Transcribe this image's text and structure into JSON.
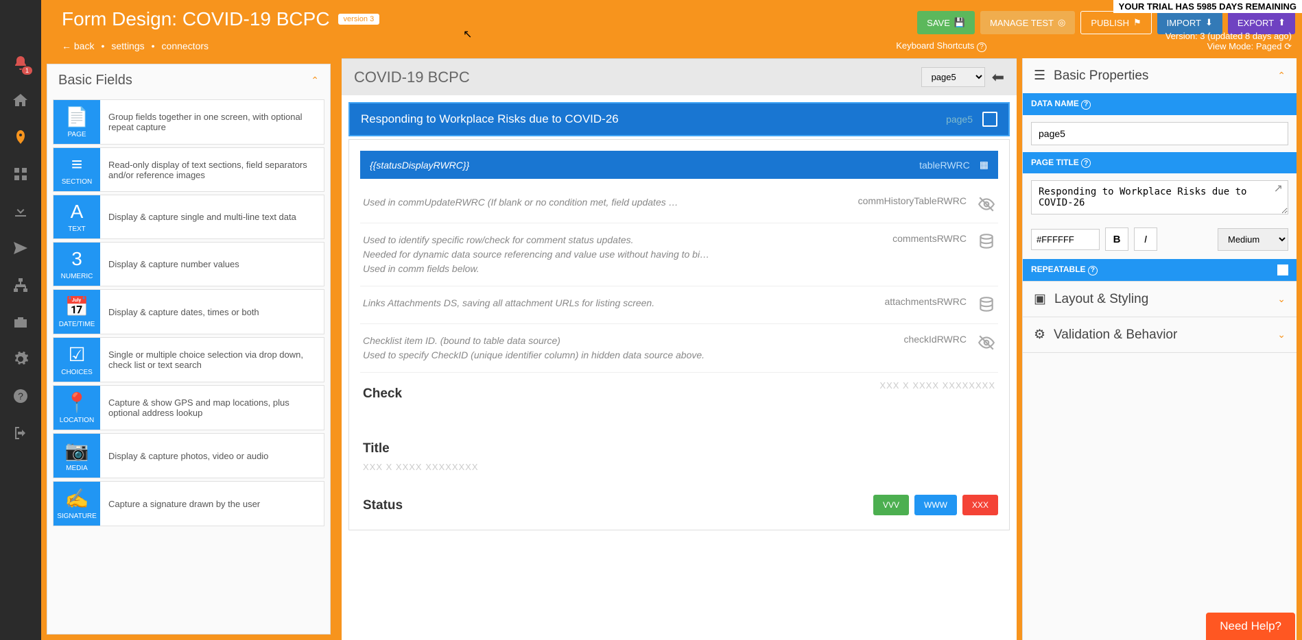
{
  "trial": "YOUR TRIAL HAS 5985 DAYS REMAINING",
  "header": {
    "title": "Form Design: COVID-19 BCPC",
    "version_badge": "version 3",
    "buttons": {
      "save": "SAVE",
      "manage": "MANAGE TEST",
      "publish": "PUBLISH",
      "import": "IMPORT",
      "export": "EXPORT"
    }
  },
  "subheader": {
    "back": "back",
    "settings": "settings",
    "connectors": "connectors",
    "kbd": "Keyboard Shortcuts",
    "version_info": "Version: 3 (updated 8 days ago)",
    "view_mode": "View Mode: Paged"
  },
  "fields_panel": {
    "title": "Basic Fields",
    "items": [
      {
        "icon": "page",
        "label": "PAGE",
        "desc": "Group fields together in one screen, with optional repeat capture"
      },
      {
        "icon": "section",
        "label": "SECTION",
        "desc": "Read-only display of text sections, field separators and/or reference images"
      },
      {
        "icon": "text",
        "label": "TEXT",
        "desc": "Display & capture single and multi-line text data"
      },
      {
        "icon": "numeric",
        "label": "NUMERIC",
        "desc": "Display & capture number values"
      },
      {
        "icon": "datetime",
        "label": "DATE/TIME",
        "desc": "Display & capture dates, times or both"
      },
      {
        "icon": "choices",
        "label": "CHOICES",
        "desc": "Single or multiple choice selection via drop down, check list or text search"
      },
      {
        "icon": "location",
        "label": "LOCATION",
        "desc": "Capture & show GPS and map locations, plus optional address lookup"
      },
      {
        "icon": "media",
        "label": "MEDIA",
        "desc": "Display & capture photos, video or audio"
      },
      {
        "icon": "signature",
        "label": "SIGNATURE",
        "desc": "Capture a signature drawn by the user"
      }
    ]
  },
  "canvas": {
    "title": "COVID-19 BCPC",
    "page_select": "page5",
    "page_header": "Responding to Workplace Risks due to COVID-26",
    "page_name": "page5",
    "section_expr": "{{statusDisplayRWRC}}",
    "section_name": "tableRWRC",
    "rows": [
      {
        "text": "Used in commUpdateRWRC (If blank or no condition met, field updates …",
        "name": "commHistoryTableRWRC",
        "icon": "eye-off"
      },
      {
        "text": "Used to identify specific row/check for comment status updates.\nNeeded for dynamic data source referencing and value use without having to bi…\nUsed in comm fields below.",
        "name": "commentsRWRC",
        "icon": "db"
      },
      {
        "text": "Links Attachments DS, saving all attachment URLs for listing screen.",
        "name": "attachmentsRWRC",
        "icon": "db"
      },
      {
        "text": "Checklist item ID. (bound to table data source)\nUsed to specify CheckID (unique identifier column) in hidden data source above.",
        "name": "checkIdRWRC",
        "icon": "eye-off"
      }
    ],
    "check_label": "Check",
    "check_placeholder": "XXX X XXXX XXXXXXXX",
    "title_label": "Title",
    "title_placeholder": "XXX X XXXX XXXXXXXX",
    "status_label": "Status",
    "status_btns": {
      "g": "VVV",
      "b": "WWW",
      "r": "XXX"
    }
  },
  "props": {
    "basic_title": "Basic Properties",
    "data_name_label": "DATA NAME",
    "data_name_value": "page5",
    "page_title_label": "PAGE TITLE",
    "page_title_value": "Responding to Workplace Risks due to COVID-26",
    "color_value": "#FFFFFF",
    "size_value": "Medium",
    "repeatable_label": "REPEATABLE",
    "layout_title": "Layout & Styling",
    "validation_title": "Validation & Behavior"
  },
  "need_help": "Need Help?"
}
